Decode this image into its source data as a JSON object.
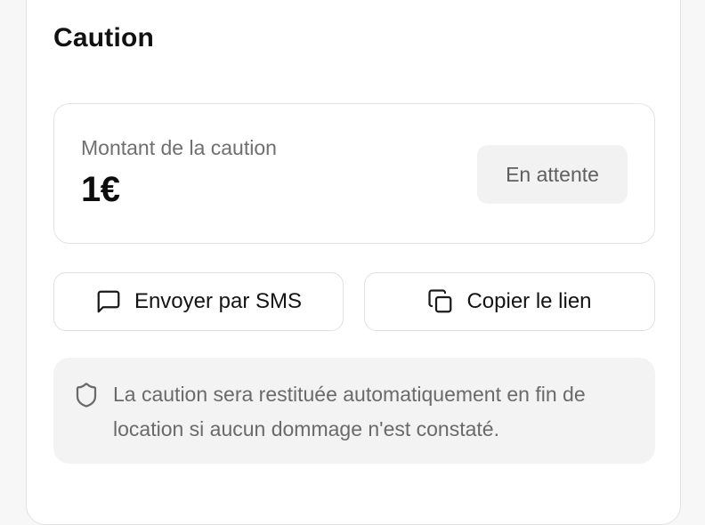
{
  "section": {
    "title": "Caution"
  },
  "deposit": {
    "label": "Montant de la caution",
    "amount": "1€",
    "status": "En attente"
  },
  "actions": {
    "sms_label": "Envoyer par SMS",
    "sms_icon": "message-square-icon",
    "copy_label": "Copier le lien",
    "copy_icon": "copy-icon"
  },
  "info": {
    "icon": "shield-icon",
    "text": "La caution sera restituée automatiquement en fin de location si aucun dommage n'est constaté."
  }
}
